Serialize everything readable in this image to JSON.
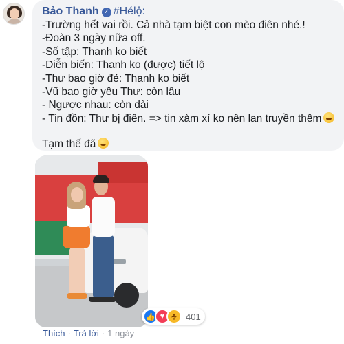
{
  "comment": {
    "author": "Bảo Thanh",
    "hashtag": "#Hélộ:",
    "lines": [
      "-Trường hết vai rồi. Cả nhà tạm biệt con mèo điên nhé.!",
      "-Đoàn 3 ngày nữa off.",
      "-Số tập: Thanh ko biết",
      "-Diễn biến: Thanh ko (được) tiết lộ",
      "-Thư bao giờ đẻ: Thanh ko biết",
      "-Vũ bao giờ yêu Thư: còn lâu",
      "- Ngược nhau: còn dài",
      "- Tin đồn: Thư bị điên. => tin xàm xí ko nên lan truyền thêm"
    ],
    "closing": "Tạm thế đã",
    "emojis": [
      "grin-emoji",
      "smile-sweat-emoji"
    ]
  },
  "reactions": {
    "types": [
      "like",
      "love",
      "haha"
    ],
    "count": "401"
  },
  "actions": {
    "like": "Thích",
    "reply": "Trả lời",
    "time": "1 ngày"
  },
  "colors": {
    "name": "#385898",
    "bubble": "#f2f3f5",
    "like": "#1877f2",
    "love": "#f33e58",
    "haha": "#f7b928"
  }
}
